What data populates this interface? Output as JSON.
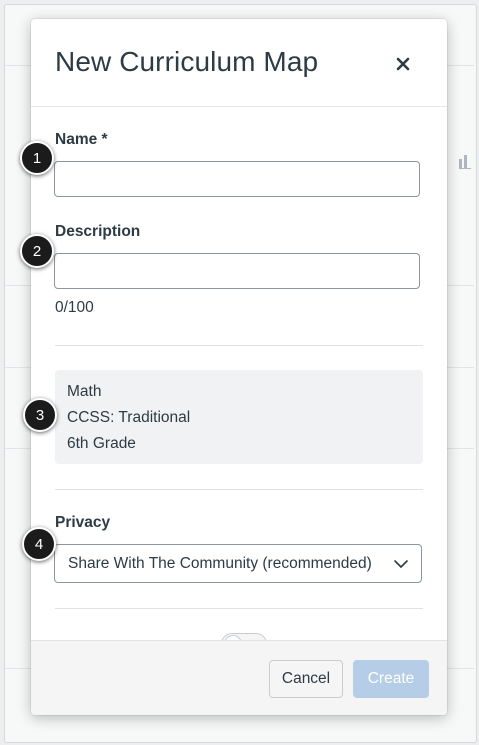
{
  "modal": {
    "title": "New Curriculum Map",
    "close_icon": "close-icon"
  },
  "fields": {
    "name": {
      "label": "Name *",
      "value": ""
    },
    "description": {
      "label": "Description",
      "value": "",
      "counter": "0/100"
    }
  },
  "info": {
    "lines": [
      "Math",
      "CCSS: Traditional",
      "6th Grade"
    ]
  },
  "privacy": {
    "label": "Privacy",
    "selected": "Share With The Community (recommended)",
    "chevron_icon": "chevron-down-icon"
  },
  "footer": {
    "cancel_label": "Cancel",
    "create_label": "Create"
  },
  "callouts": [
    "1",
    "2",
    "3",
    "4"
  ],
  "colors": {
    "text": "#2d3b45",
    "create_disabled": "#b5cde6",
    "callout": "#1b1b1b"
  }
}
